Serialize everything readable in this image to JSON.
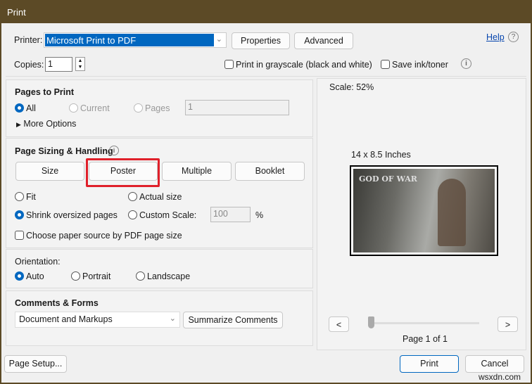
{
  "window": {
    "title": "Print"
  },
  "printer": {
    "label": "Printer:",
    "value": "Microsoft Print to PDF",
    "properties": "Properties",
    "advanced": "Advanced",
    "help": "Help"
  },
  "copies": {
    "label": "Copies:",
    "value": "1"
  },
  "options": {
    "grayscale": "Print in grayscale (black and white)",
    "grayscale_checked": false,
    "save_ink": "Save ink/toner",
    "save_ink_checked": false
  },
  "pages_to_print": {
    "title": "Pages to Print",
    "all": "All",
    "current": "Current",
    "pages": "Pages",
    "pages_value": "1",
    "more_options": "More Options",
    "selected": "All"
  },
  "page_sizing": {
    "title": "Page Sizing & Handling",
    "tabs": [
      "Size",
      "Poster",
      "Multiple",
      "Booklet"
    ],
    "active_tab": "Poster",
    "fit": "Fit",
    "actual_size": "Actual size",
    "shrink": "Shrink oversized pages",
    "custom_scale": "Custom Scale:",
    "custom_value": "100",
    "percent": "%",
    "selected": "Shrink oversized pages",
    "paper_source": "Choose paper source by PDF page size",
    "highlight_color": "#e0202a"
  },
  "orientation": {
    "title": "Orientation:",
    "auto": "Auto",
    "portrait": "Portrait",
    "landscape": "Landscape",
    "selected": "Auto"
  },
  "comments": {
    "title": "Comments & Forms",
    "value": "Document and Markups",
    "summarize": "Summarize Comments"
  },
  "preview": {
    "scale": "Scale:  52%",
    "size": "14 x 8.5 Inches",
    "page": "Page 1 of 1",
    "prev": "<",
    "next": ">",
    "image_text": "GOD OF WAR"
  },
  "footer": {
    "page_setup": "Page Setup...",
    "print": "Print",
    "cancel": "Cancel",
    "watermark": "wsxdn.com"
  },
  "colors": {
    "accent": "#0067c0",
    "titlebar": "#5c4a26"
  }
}
